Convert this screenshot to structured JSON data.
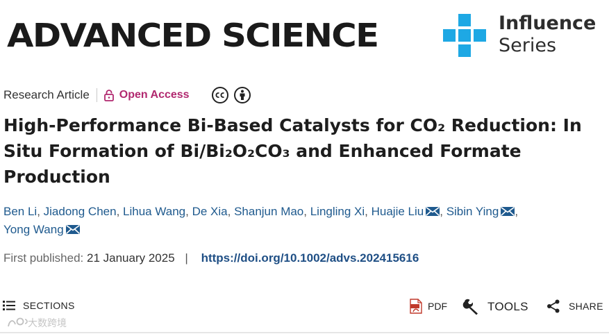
{
  "header": {
    "journal_logo": "ADVANCED SCIENCE",
    "series_logo": {
      "line1": "Influence",
      "line2": "Series",
      "icon": "cross-grid-logo",
      "color": "#1ea8e4"
    }
  },
  "meta": {
    "article_type": "Research Article",
    "access_label": "Open Access",
    "access_icon": "lock-open-icon",
    "access_color": "#b1286f",
    "license_icons": [
      "cc-icon",
      "attribution-icon"
    ]
  },
  "title": {
    "line1": "High-Performance Bi-Based Catalysts for CO₂ Reduction: In",
    "line2": "Situ Formation of Bi/Bi₂O₂CO₃ and Enhanced Formate",
    "line3": "Production"
  },
  "authors": [
    {
      "name": "Ben Li",
      "corresponding": false
    },
    {
      "name": "Jiadong Chen",
      "corresponding": false
    },
    {
      "name": "Lihua Wang",
      "corresponding": false
    },
    {
      "name": "De Xia",
      "corresponding": false
    },
    {
      "name": "Shanjun Mao",
      "corresponding": false
    },
    {
      "name": "Lingling Xi",
      "corresponding": false
    },
    {
      "name": "Huajie Liu",
      "corresponding": true
    },
    {
      "name": "Sibin Ying",
      "corresponding": true
    },
    {
      "name": "Yong Wang",
      "corresponding": true
    }
  ],
  "publication": {
    "label": "First published:",
    "date": "21 January 2025",
    "separator": "|",
    "doi": "https://doi.org/10.1002/advs.202415616"
  },
  "toolbar": {
    "sections_label": "SECTIONS",
    "pdf_label": "PDF",
    "tools_label": "TOOLS",
    "share_label": "SHARE"
  },
  "watermark": {
    "text": "大数跨境"
  },
  "colors": {
    "link": "#1f5a8e",
    "doi": "#1f4f85",
    "accent": "#b1286f"
  }
}
